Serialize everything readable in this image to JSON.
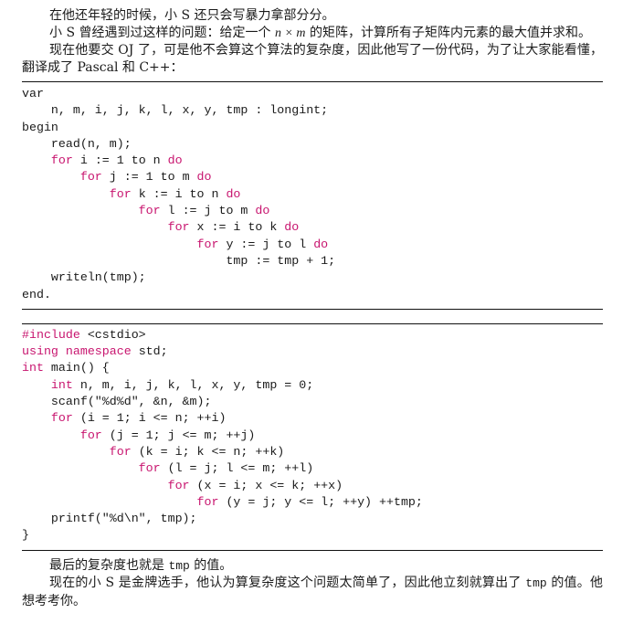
{
  "intro": {
    "p1": "在他还年轻的时候，小 S 还只会写暴力拿部分分。",
    "p2_before": "小 S 曾经遇到过这样的问题：给定一个 ",
    "p2_math": "n × m",
    "p2_after": " 的矩阵，计算所有子矩阵内元素的最大值并求和。",
    "p3": "现在他要交 OJ 了，可是他不会算这个算法的复杂度，因此他写了一份代码，为了让大家能看懂，翻译成了 Pascal 和 C++："
  },
  "pascal_code": {
    "lines": [
      [
        {
          "t": "var",
          "k": false
        }
      ],
      [
        {
          "t": "    n, m, i, j, k, l, x, y, tmp : longint;",
          "k": false
        }
      ],
      [
        {
          "t": "begin",
          "k": false
        }
      ],
      [
        {
          "t": "    read(n, m);",
          "k": false
        }
      ],
      [
        {
          "t": "    ",
          "k": false
        },
        {
          "t": "for",
          "k": true
        },
        {
          "t": " i := 1 to n ",
          "k": false
        },
        {
          "t": "do",
          "k": true
        }
      ],
      [
        {
          "t": "        ",
          "k": false
        },
        {
          "t": "for",
          "k": true
        },
        {
          "t": " j := 1 to m ",
          "k": false
        },
        {
          "t": "do",
          "k": true
        }
      ],
      [
        {
          "t": "            ",
          "k": false
        },
        {
          "t": "for",
          "k": true
        },
        {
          "t": " k := i to n ",
          "k": false
        },
        {
          "t": "do",
          "k": true
        }
      ],
      [
        {
          "t": "                ",
          "k": false
        },
        {
          "t": "for",
          "k": true
        },
        {
          "t": " l := j to m ",
          "k": false
        },
        {
          "t": "do",
          "k": true
        }
      ],
      [
        {
          "t": "                    ",
          "k": false
        },
        {
          "t": "for",
          "k": true
        },
        {
          "t": " x := i to k ",
          "k": false
        },
        {
          "t": "do",
          "k": true
        }
      ],
      [
        {
          "t": "                        ",
          "k": false
        },
        {
          "t": "for",
          "k": true
        },
        {
          "t": " y := j to l ",
          "k": false
        },
        {
          "t": "do",
          "k": true
        }
      ],
      [
        {
          "t": "                            tmp := tmp + 1;",
          "k": false
        }
      ],
      [
        {
          "t": "    writeln(tmp);",
          "k": false
        }
      ],
      [
        {
          "t": "end.",
          "k": false
        }
      ]
    ]
  },
  "cpp_code": {
    "lines": [
      [
        {
          "t": "#include",
          "k": true
        },
        {
          "t": " <cstdio>",
          "k": false
        }
      ],
      [
        {
          "t": "using",
          "k": true
        },
        {
          "t": " ",
          "k": false
        },
        {
          "t": "namespace",
          "k": true
        },
        {
          "t": " std;",
          "k": false
        }
      ],
      [
        {
          "t": "int",
          "k": true
        },
        {
          "t": " main() {",
          "k": false
        }
      ],
      [
        {
          "t": "    ",
          "k": false
        },
        {
          "t": "int",
          "k": true
        },
        {
          "t": " n, m, i, j, k, l, x, y, tmp = 0;",
          "k": false
        }
      ],
      [
        {
          "t": "    scanf(\"%d%d\", &n, &m);",
          "k": false
        }
      ],
      [
        {
          "t": "    ",
          "k": false
        },
        {
          "t": "for",
          "k": true
        },
        {
          "t": " (i = 1; i <= n; ++i)",
          "k": false
        }
      ],
      [
        {
          "t": "        ",
          "k": false
        },
        {
          "t": "for",
          "k": true
        },
        {
          "t": " (j = 1; j <= m; ++j)",
          "k": false
        }
      ],
      [
        {
          "t": "            ",
          "k": false
        },
        {
          "t": "for",
          "k": true
        },
        {
          "t": " (k = i; k <= n; ++k)",
          "k": false
        }
      ],
      [
        {
          "t": "                ",
          "k": false
        },
        {
          "t": "for",
          "k": true
        },
        {
          "t": " (l = j; l <= m; ++l)",
          "k": false
        }
      ],
      [
        {
          "t": "                    ",
          "k": false
        },
        {
          "t": "for",
          "k": true
        },
        {
          "t": " (x = i; x <= k; ++x)",
          "k": false
        }
      ],
      [
        {
          "t": "                        ",
          "k": false
        },
        {
          "t": "for",
          "k": true
        },
        {
          "t": " (y = j; y <= l; ++y) ++tmp;",
          "k": false
        }
      ],
      [
        {
          "t": "    printf(\"%d\\n\", tmp);",
          "k": false
        }
      ],
      [
        {
          "t": "}",
          "k": false
        }
      ]
    ]
  },
  "outro": {
    "p1_before": "最后的复杂度也就是 ",
    "p1_code": "tmp",
    "p1_after": " 的值。",
    "p2_before": "现在的小 S 是金牌选手，他认为算复杂度这个问题太简单了，因此他立刻就算出了 ",
    "p2_code": "tmp",
    "p2_after": " 的值。他想考考你。"
  },
  "colors": {
    "keyword": "#c8156f",
    "text": "#1a1a1a",
    "rule": "#111111"
  }
}
